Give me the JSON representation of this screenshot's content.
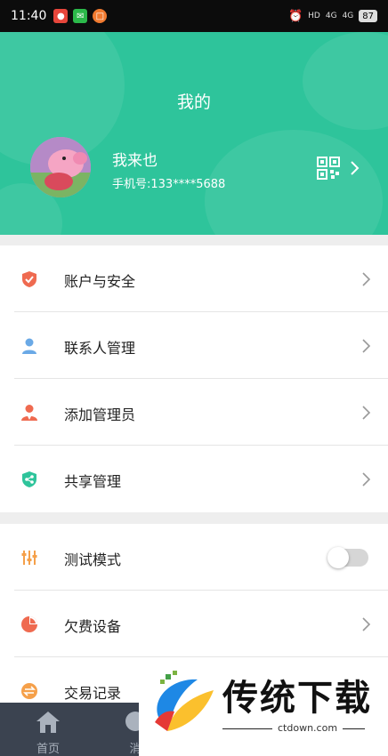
{
  "status_bar": {
    "time": "11:40",
    "network_1": "4G",
    "network_2": "4G",
    "hd": "HD",
    "battery": "87"
  },
  "header": {
    "title": "我的",
    "user_name": "我来也",
    "phone": "手机号:133****5688",
    "bg_color": "#2ec49b"
  },
  "menu_group_1": [
    {
      "label": "账户与安全",
      "icon": "shield-check-icon",
      "color": "#ef6a50"
    },
    {
      "label": "联系人管理",
      "icon": "person-icon",
      "color": "#6aa9e6"
    },
    {
      "label": "添加管理员",
      "icon": "admin-person-icon",
      "color": "#ef6a50"
    },
    {
      "label": "共享管理",
      "icon": "share-shield-icon",
      "color": "#2ec49b"
    }
  ],
  "menu_group_2": [
    {
      "label": "测试模式",
      "icon": "sliders-icon",
      "color": "#f5a04a",
      "toggle": false
    },
    {
      "label": "欠费设备",
      "icon": "pie-chart-icon",
      "color": "#ef6a50"
    },
    {
      "label": "交易记录",
      "icon": "exchange-icon",
      "color": "#f5a04a"
    }
  ],
  "bottom_nav": {
    "home_label": "首页",
    "second_label": "消"
  },
  "watermark": {
    "brand": "传统下载",
    "site": "ctdown.com"
  }
}
